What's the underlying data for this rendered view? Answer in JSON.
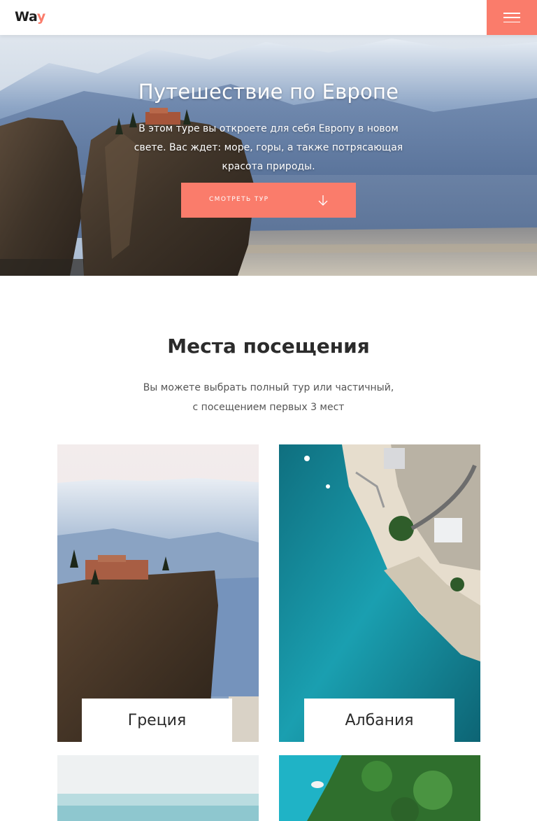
{
  "header": {
    "logo_main": "Wa",
    "logo_accent": "y",
    "menu_icon": "hamburger-icon",
    "accent_color": "#fa7c6b"
  },
  "hero": {
    "title": "Путешествие по Европе",
    "description": "В этом туре вы откроете для себя Европу в новом свете. Вас ждет: море, горы, а также потрясающая красота природы.",
    "button_label": "смотреть тур",
    "button_icon": "arrow-down-icon"
  },
  "places": {
    "title": "Места посещения",
    "subtitle": "Вы можете выбрать полный тур или частичный, с посещением первых 3 мест",
    "cards": [
      {
        "label": "Греция"
      },
      {
        "label": "Албания"
      }
    ]
  }
}
